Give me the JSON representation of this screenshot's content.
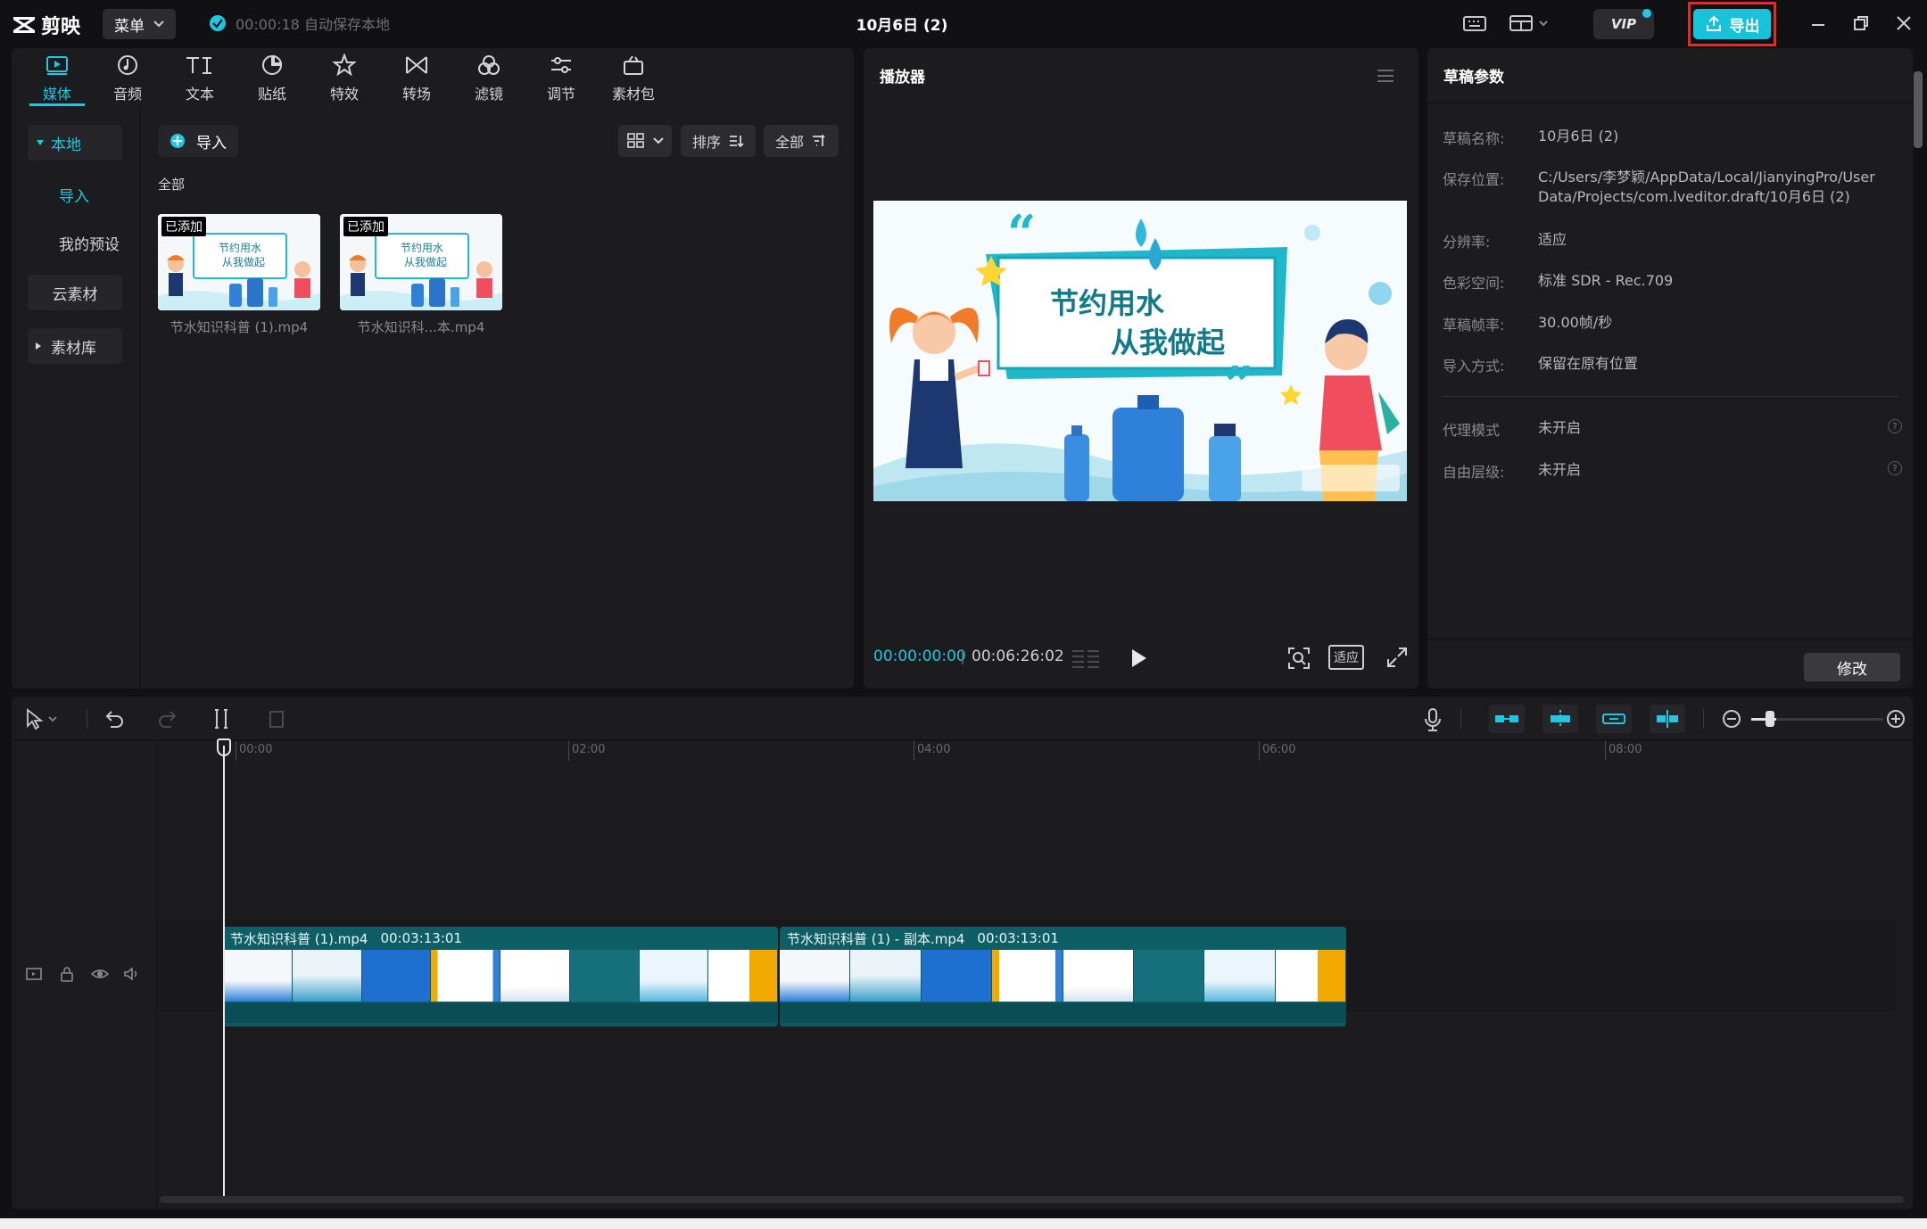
{
  "app": {
    "name": "剪映",
    "menu_label": "菜单",
    "autosave_text": "00:00:18 自动保存本地",
    "document_title": "10月6日 (2)",
    "vip_label": "VIP",
    "export_label": "导出"
  },
  "tabs": [
    {
      "label": "媒体",
      "icon": "media-icon",
      "active": true
    },
    {
      "label": "音频",
      "icon": "audio-icon"
    },
    {
      "label": "文本",
      "icon": "text-icon"
    },
    {
      "label": "贴纸",
      "icon": "sticker-icon"
    },
    {
      "label": "特效",
      "icon": "effects-icon"
    },
    {
      "label": "转场",
      "icon": "transition-icon"
    },
    {
      "label": "滤镜",
      "icon": "filter-icon"
    },
    {
      "label": "调节",
      "icon": "adjust-icon"
    },
    {
      "label": "素材包",
      "icon": "package-icon"
    }
  ],
  "sidebar": {
    "items": [
      {
        "label": "本地",
        "selected_section": true
      },
      {
        "label": "导入",
        "selected": true
      },
      {
        "label": "我的预设"
      },
      {
        "label": "云素材"
      },
      {
        "label": "素材库"
      }
    ]
  },
  "library": {
    "import_label": "导入",
    "sort_label": "排序",
    "filter_label": "全部",
    "section_label": "全部",
    "items": [
      {
        "badge": "已添加",
        "name": "节水知识科普 (1).mp4",
        "thumb_text": [
          "节约用水",
          "从我做起"
        ]
      },
      {
        "badge": "已添加",
        "name": "节水知识科...本.mp4",
        "thumb_text": [
          "节约用水",
          "从我做起"
        ]
      }
    ]
  },
  "player": {
    "title": "播放器",
    "current_time": "00:00:00:00",
    "total_time": "00:06:26:02",
    "preview_text": [
      "节约用水",
      "从我做起"
    ],
    "fit_label": "适应"
  },
  "draft": {
    "title": "草稿参数",
    "fields": [
      {
        "key": "草稿名称:",
        "value": "10月6日 (2)"
      },
      {
        "key": "保存位置:",
        "value": "C:/Users/李梦颖/AppData/Local/JianyingPro/User Data/Projects/com.lveditor.draft/10月6日 (2)"
      },
      {
        "key": "分辨率:",
        "value": "适应"
      },
      {
        "key": "色彩空间:",
        "value": "标准 SDR - Rec.709"
      },
      {
        "key": "草稿帧率:",
        "value": "30.00帧/秒"
      },
      {
        "key": "导入方式:",
        "value": "保留在原有位置"
      }
    ],
    "extra_fields": [
      {
        "key": "代理模式",
        "value": "未开启"
      },
      {
        "key": "自由层级:",
        "value": "未开启"
      }
    ],
    "modify_label": "修改"
  },
  "timeline": {
    "ruler_labels": [
      "00:00",
      "02:00",
      "04:00",
      "06:00",
      "08:00"
    ],
    "cover_label": "封面",
    "clips": [
      {
        "name": "节水知识科普 (1).mp4",
        "duration": "00:03:13:01"
      },
      {
        "name": "节水知识科普 (1) - 副本.mp4",
        "duration": "00:03:13:01"
      }
    ]
  },
  "colors": {
    "accent": "#1ec8e0",
    "export_highlight": "#e22c2c",
    "clip": "#0d5a61",
    "background": "#111113",
    "panel": "#1c1c1e"
  }
}
